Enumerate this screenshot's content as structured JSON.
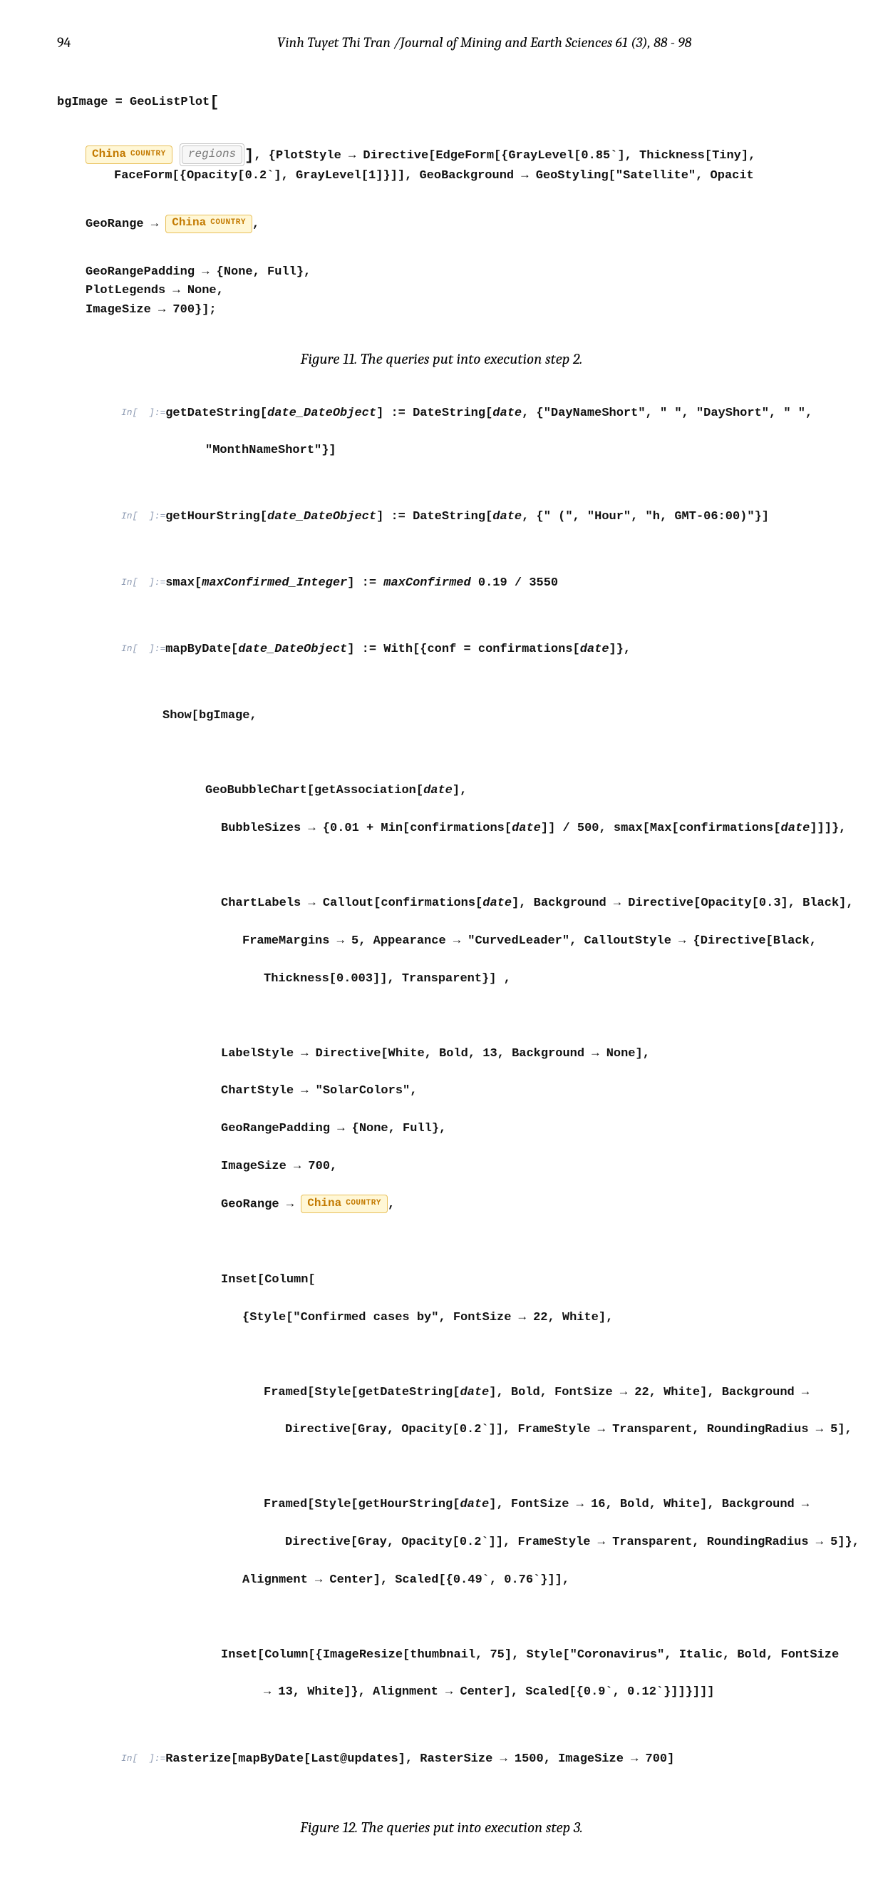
{
  "header": {
    "page_number": "94",
    "journal": "Vinh Tuyet Thi Tran /Journal of Mining and Earth Sciences 61 (3), 88 - 98"
  },
  "figure11_caption": "Figure 11. The queries put into execution step 2.",
  "figure12_caption": "Figure 12. The queries put into execution step 3.",
  "entity": {
    "china_name": "China",
    "country_label": "COUNTRY",
    "regions_name": "regions"
  },
  "code1": {
    "l1a": "bgImage = GeoListPlot",
    "l2_tail": ", {PlotStyle → Directive[EdgeForm[{GrayLevel[0.85`], Thickness[Tiny],",
    "l3": "FaceForm[{Opacity[0.2`], GrayLevel[1]}]], GeoBackground → GeoStyling[\"Satellite\", Opacit",
    "l4a": "GeoRange → ",
    "l4b": ",",
    "l5": "GeoRangePadding → {None, Full},",
    "l6": "PlotLegends → None,",
    "l7": "ImageSize → 700}];"
  },
  "in_label": "In[  ]:=",
  "code2": {
    "l01a": "getDateString[",
    "l01b": "date_DateObject",
    "l01c": "] := DateString[",
    "l01d": "date",
    "l01e": ", {\"DayNameShort\", \" \", \"DayShort\", \" \",",
    "l02": "\"MonthNameShort\"}]",
    "l03a": "getHourString[",
    "l03b": "date_DateObject",
    "l03c": "] := DateString[",
    "l03d": "date",
    "l03e": ", {\" (\", \"Hour\", \"h, GMT-06:00)\"}]",
    "l04a": "smax[",
    "l04b": "maxConfirmed_Integer",
    "l04c": "] := ",
    "l04d": "maxConfirmed",
    "l04e": " 0.19 / 3550",
    "l05a": "mapByDate[",
    "l05b": "date_DateObject",
    "l05c": "] := With[{conf = confirmations[",
    "l05d": "date",
    "l05e": "]},",
    "l06": "Show[bgImage,",
    "l07a": "GeoBubbleChart[getAssociation[",
    "l07b": "date",
    "l07c": "],",
    "l08a": "BubbleSizes → {0.01 + Min[confirmations[",
    "l08b": "date",
    "l08c": "]] / 500, smax[Max[confirmations[",
    "l08d": "date",
    "l08e": "]]]},",
    "l09a": "ChartLabels → Callout[confirmations[",
    "l09b": "date",
    "l09c": "], Background → Directive[Opacity[0.3], Black],",
    "l10": "FrameMargins → 5, Appearance → \"CurvedLeader\", CalloutStyle → {Directive[Black,",
    "l11": "Thickness[0.003]], Transparent}] ,",
    "l12": "LabelStyle → Directive[White, Bold, 13, Background → None],",
    "l13": "ChartStyle → \"SolarColors\",",
    "l14": "GeoRangePadding → {None, Full},",
    "l15": "ImageSize → 700,",
    "l16a": "GeoRange → ",
    "l16b": ",",
    "l17": "Inset[Column[",
    "l18": "{Style[\"Confirmed cases by\", FontSize → 22, White],",
    "l19a": "Framed[Style[getDateString[",
    "l19b": "date",
    "l19c": "], Bold, FontSize → 22, White], Background →",
    "l20": "Directive[Gray, Opacity[0.2`]], FrameStyle → Transparent, RoundingRadius → 5],",
    "l21a": "Framed[Style[getHourString[",
    "l21b": "date",
    "l21c": "], FontSize → 16, Bold, White], Background →",
    "l22": "Directive[Gray, Opacity[0.2`]], FrameStyle → Transparent, RoundingRadius → 5]},",
    "l23": "Alignment → Center], Scaled[{0.49`, 0.76`}]],",
    "l24": "Inset[Column[{ImageResize[thumbnail, 75], Style[\"Coronavirus\", Italic, Bold, FontSize",
    "l25": "→ 13, White]}, Alignment → Center], Scaled[{0.9`, 0.12`}]]}]]]",
    "l26": "Rasterize[mapByDate[Last@updates], RasterSize → 1500, ImageSize → 700]"
  }
}
